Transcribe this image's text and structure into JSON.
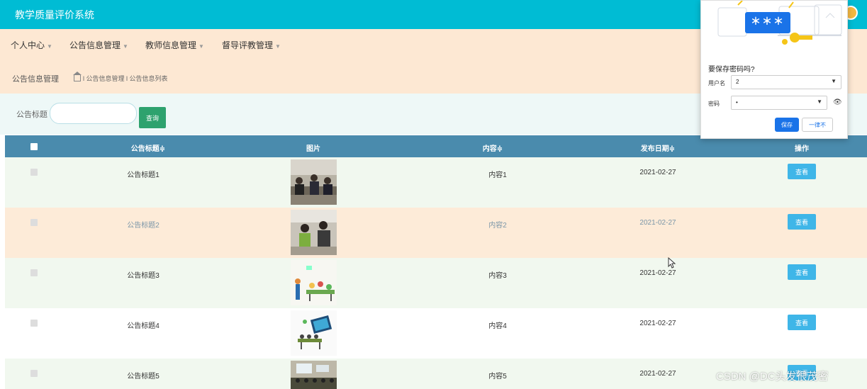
{
  "app": {
    "title": "教学质量评价系统"
  },
  "nav": {
    "items": [
      {
        "label": "个人中心"
      },
      {
        "label": "公告信息管理"
      },
      {
        "label": "教师信息管理"
      },
      {
        "label": "督导评教管理"
      }
    ]
  },
  "breadcrumb": {
    "title": "公告信息管理",
    "path": "l 公告信息管理 l 公告信息列表"
  },
  "search": {
    "label": "公告标题",
    "value": "",
    "placeholder": "",
    "button_label": "查询"
  },
  "table": {
    "headers": [
      "公告标题≑",
      "图片",
      "内容≑",
      "发布日期≑",
      "操作"
    ],
    "rows": [
      {
        "title": "公告标题1",
        "content": "内容1",
        "date": "2021-02-27",
        "action": "查看",
        "image": "classroom-photo"
      },
      {
        "title": "公告标题2",
        "content": "内容2",
        "date": "2021-02-27",
        "action": "查看",
        "image": "teacher-student-photo"
      },
      {
        "title": "公告标题3",
        "content": "内容3",
        "date": "2021-02-27",
        "action": "查看",
        "image": "classroom-illustration"
      },
      {
        "title": "公告标题4",
        "content": "内容4",
        "date": "2021-02-27",
        "action": "查看",
        "image": "lecture-illustration"
      },
      {
        "title": "公告标题5",
        "content": "内容5",
        "date": "2021-02-27",
        "action": "查看",
        "image": "auditorium-photo"
      }
    ]
  },
  "password_popup": {
    "title": "要保存密码吗?",
    "username_label": "用户名",
    "username_value": "2",
    "password_label": "密码",
    "password_value": "•",
    "mask_text": "＊＊＊",
    "save_label": "保存",
    "never_label": "一律不"
  },
  "watermark": "CSDN @DC头发很茂密",
  "colors": {
    "header": "#00bcd4",
    "nav_bg": "#fde8d3",
    "table_header": "#4a8bad",
    "view_button": "#3fb6e8",
    "search_button": "#2ea26e",
    "save_button": "#1a73e8"
  }
}
